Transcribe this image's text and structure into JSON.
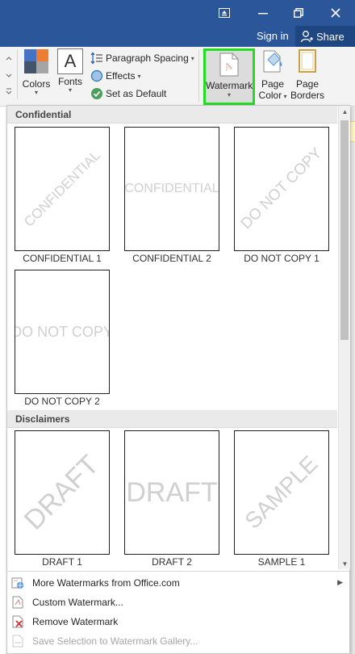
{
  "titlebar": {
    "restore_ribbon_icon": "ribbon-display-options-icon",
    "minimize_icon": "minimize-icon",
    "maximize_icon": "restore-window-icon",
    "close_icon": "close-icon"
  },
  "account": {
    "sign_in": "Sign in",
    "share": "Share"
  },
  "ribbon": {
    "colors": "Colors",
    "fonts": "Fonts",
    "fonts_glyph": "A",
    "paragraph_spacing": "Paragraph Spacing",
    "effects": "Effects",
    "set_default": "Set as Default",
    "watermark": "Watermark",
    "page_color_line1": "Page",
    "page_color_line2": "Color",
    "page_borders_line1": "Page",
    "page_borders_line2": "Borders"
  },
  "gallery": {
    "sections": [
      {
        "title": "Confidential",
        "items": [
          {
            "caption": "CONFIDENTIAL 1",
            "text": "CONFIDENTIAL",
            "style": "diagonal"
          },
          {
            "caption": "CONFIDENTIAL 2",
            "text": "CONFIDENTIAL",
            "style": "horizontal"
          },
          {
            "caption": "DO NOT COPY 1",
            "text": "DO NOT COPY",
            "style": "diagonal"
          },
          {
            "caption": "DO NOT COPY 2",
            "text": "DO NOT COPY",
            "style": "horizontal"
          }
        ]
      },
      {
        "title": "Disclaimers",
        "items": [
          {
            "caption": "DRAFT 1",
            "text": "DRAFT",
            "style": "diagonal"
          },
          {
            "caption": "DRAFT 2",
            "text": "DRAFT",
            "style": "horizontal"
          },
          {
            "caption": "SAMPLE 1",
            "text": "SAMPLE",
            "style": "diagonal"
          }
        ]
      }
    ]
  },
  "menu": {
    "more_watermarks": "More Watermarks from Office.com",
    "custom_watermark": "Custom Watermark...",
    "remove_watermark": "Remove Watermark",
    "save_selection": "Save Selection to Watermark Gallery..."
  },
  "colors": {
    "title_bar": "#2b579a",
    "highlight_border": "#22dd22",
    "watermark_text": "#d0d0d0"
  }
}
